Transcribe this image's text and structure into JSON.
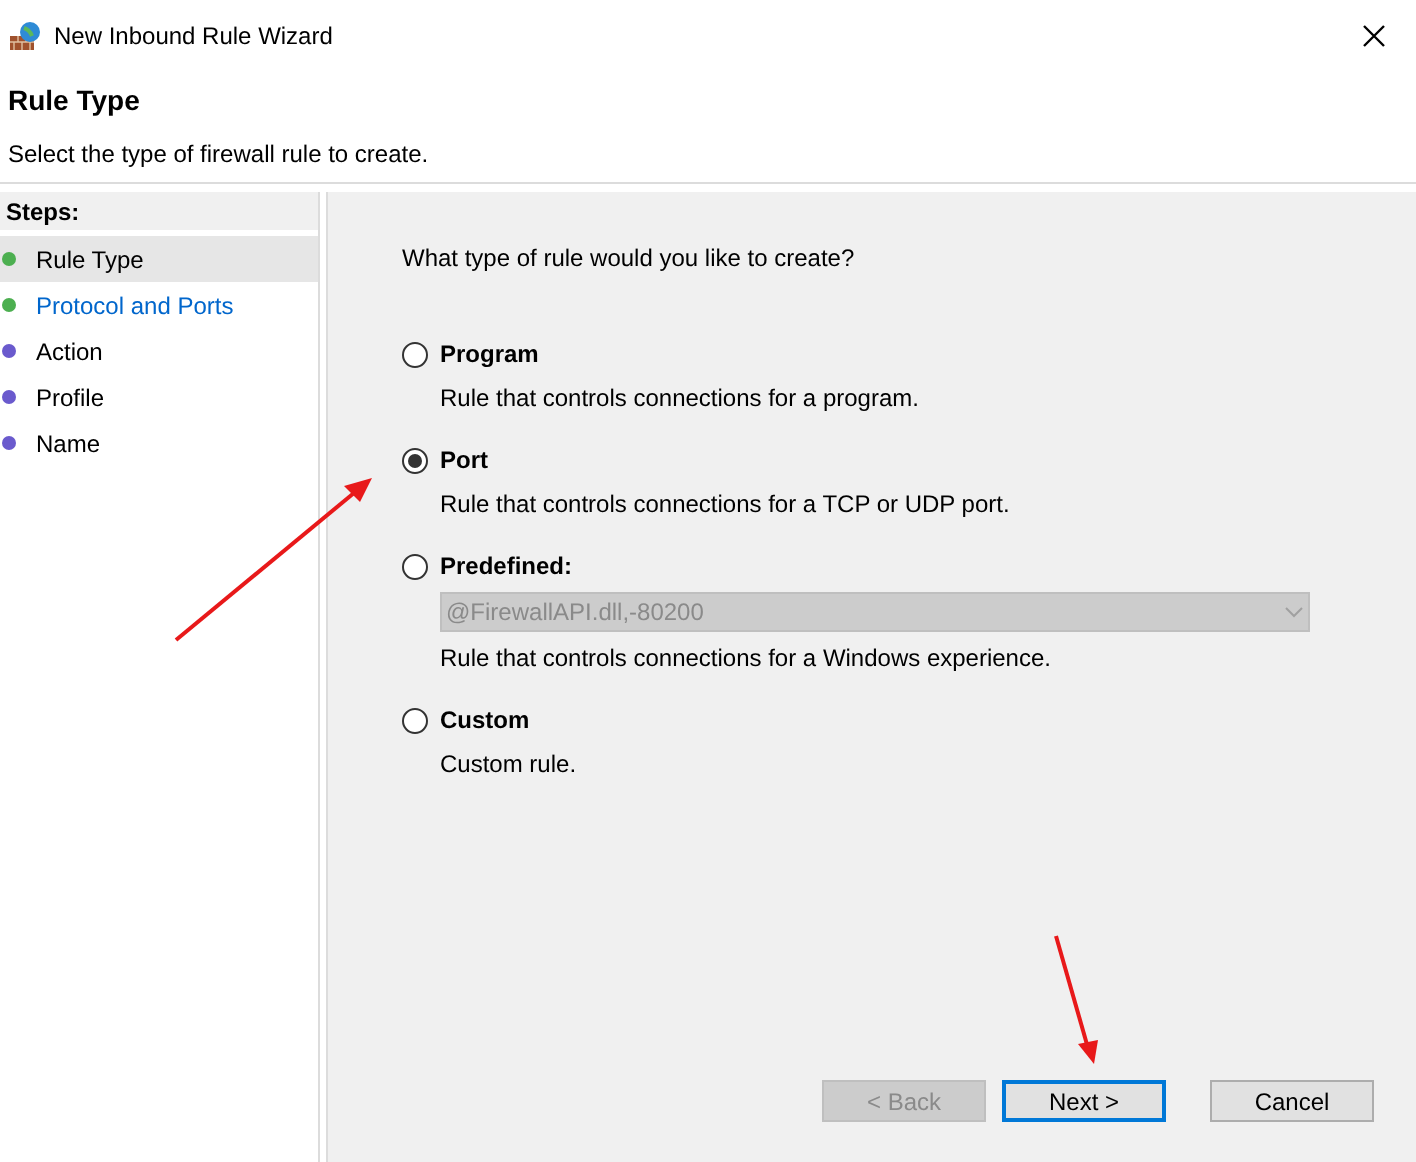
{
  "window": {
    "title": "New Inbound Rule Wizard"
  },
  "header": {
    "title": "Rule Type",
    "subtitle": "Select the type of firewall rule to create."
  },
  "steps": {
    "heading": "Steps:",
    "items": [
      {
        "label": "Rule Type",
        "color": "#4caf50",
        "selected": true,
        "current": false
      },
      {
        "label": "Protocol and Ports",
        "color": "#4caf50",
        "selected": false,
        "current": true
      },
      {
        "label": "Action",
        "color": "#6a5acd",
        "selected": false,
        "current": false
      },
      {
        "label": "Profile",
        "color": "#6a5acd",
        "selected": false,
        "current": false
      },
      {
        "label": "Name",
        "color": "#6a5acd",
        "selected": false,
        "current": false
      }
    ]
  },
  "question": "What type of rule would you like to create?",
  "options": [
    {
      "label": "Program",
      "description": "Rule that controls connections for a program.",
      "selected": false
    },
    {
      "label": "Port",
      "description": "Rule that controls connections for a TCP or UDP port.",
      "selected": true
    },
    {
      "label": "Predefined:",
      "description": "Rule that controls connections for a Windows experience.",
      "selected": false,
      "dropdown": {
        "value": "@FirewallAPI.dll,-80200",
        "disabled": true
      }
    },
    {
      "label": "Custom",
      "description": "Custom rule.",
      "selected": false
    }
  ],
  "buttons": [
    {
      "label": "< Back",
      "kind": "back",
      "disabled": true
    },
    {
      "label": "Next >",
      "kind": "next",
      "disabled": false
    },
    {
      "label": "Cancel",
      "kind": "cancel",
      "disabled": false
    }
  ]
}
